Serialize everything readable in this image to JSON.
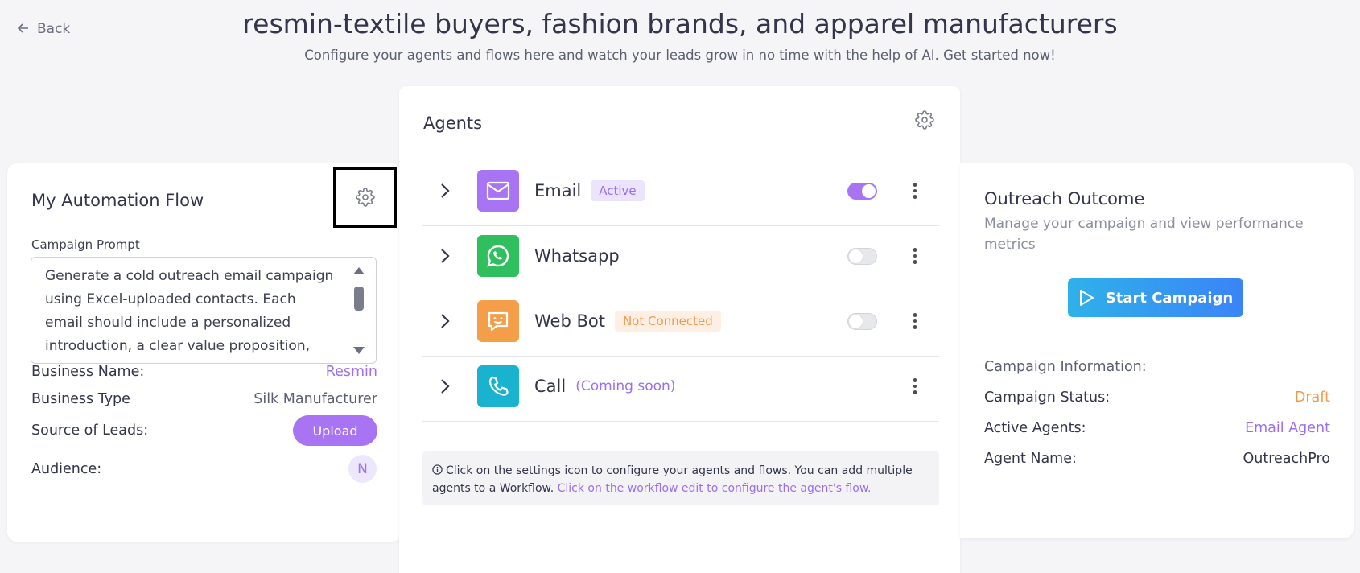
{
  "header": {
    "back_label": "Back",
    "title": "resmin-textile buyers, fashion brands, and apparel manufacturers",
    "subtitle": "Configure your agents and flows here and watch your leads grow in no time with the help of AI. Get started now!"
  },
  "automation": {
    "title": "My Automation Flow",
    "prompt_label": "Campaign Prompt",
    "prompt_text": "Generate a cold outreach email campaign using Excel-uploaded contacts. Each email should include a personalized introduction, a clear value proposition, and a call-to-",
    "business_name_label": "Business Name:",
    "business_name": "Resmin",
    "business_type_label": "Business Type",
    "business_type": "Silk Manufacturer",
    "source_label": "Source of Leads:",
    "upload_label": "Upload",
    "audience_label": "Audience:",
    "audience_initial": "N"
  },
  "agents": {
    "title": "Agents",
    "items": [
      {
        "name": "Email",
        "badge": "Active",
        "icon": "mail-icon",
        "color": "#a974f3",
        "enabled": true
      },
      {
        "name": "Whatsapp",
        "badge": "",
        "icon": "whatsapp-icon",
        "color": "#2fbf5e",
        "enabled": false
      },
      {
        "name": "Web Bot",
        "badge": "Not Connected",
        "icon": "chat-bot-icon",
        "color": "#f59e4a",
        "enabled": false
      },
      {
        "name": "Call",
        "note": "(Coming soon)",
        "icon": "phone-icon",
        "color": "#1ab3cf"
      }
    ],
    "note_text": "Click on the settings icon to configure your agents and flows. You can add multiple agents to a Workflow.",
    "note_link": "Click on the workflow edit to configure the agent's flow."
  },
  "outcome": {
    "title": "Outreach Outcome",
    "subtitle": "Manage your campaign and view performance metrics",
    "start_label": "Start Campaign",
    "info_label": "Campaign Information:",
    "status_label": "Campaign Status:",
    "status_value": "Draft",
    "active_agents_label": "Active Agents:",
    "active_agents_value": "Email Agent",
    "agent_name_label": "Agent Name:",
    "agent_name_value": "OutreachPro"
  },
  "colors": {
    "accent": "#a974f3",
    "draft": "#f2994a",
    "start_gradient": [
      "#2fb1ea",
      "#3a84f6"
    ]
  }
}
